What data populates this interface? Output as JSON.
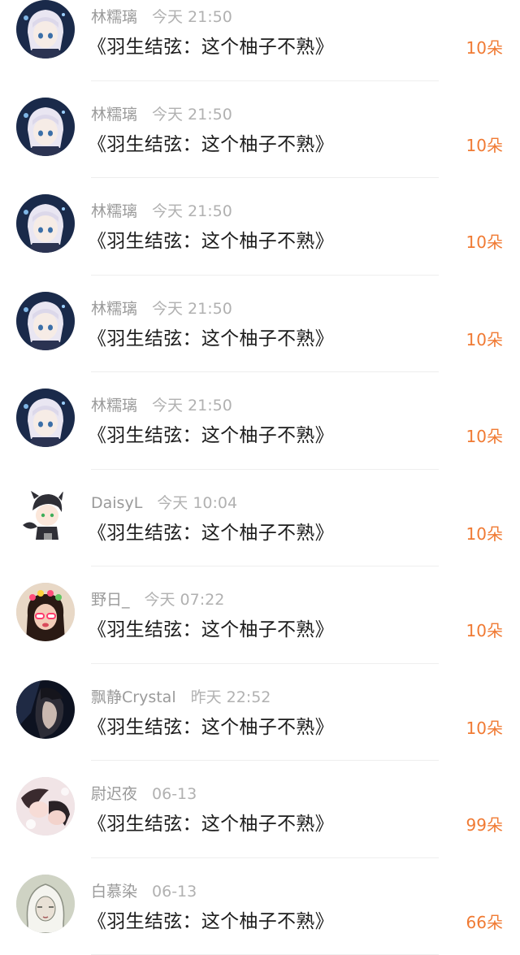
{
  "items": [
    {
      "user": "林糯璃",
      "time": "今天 21:50",
      "title": "《羽生结弦：这个柚子不熟》",
      "flowers": "10朵",
      "avatar": "anime-girl-avatar"
    },
    {
      "user": "林糯璃",
      "time": "今天 21:50",
      "title": "《羽生结弦：这个柚子不熟》",
      "flowers": "10朵",
      "avatar": "anime-girl-avatar"
    },
    {
      "user": "林糯璃",
      "time": "今天 21:50",
      "title": "《羽生结弦：这个柚子不熟》",
      "flowers": "10朵",
      "avatar": "anime-girl-avatar"
    },
    {
      "user": "林糯璃",
      "time": "今天 21:50",
      "title": "《羽生结弦：这个柚子不熟》",
      "flowers": "10朵",
      "avatar": "anime-girl-avatar"
    },
    {
      "user": "林糯璃",
      "time": "今天 21:50",
      "title": "《羽生结弦：这个柚子不熟》",
      "flowers": "10朵",
      "avatar": "anime-girl-avatar"
    },
    {
      "user": "DaisyL",
      "time": "今天 10:04",
      "title": "《羽生结弦：这个柚子不熟》",
      "flowers": "10朵",
      "avatar": "chibi-boy-cat-avatar"
    },
    {
      "user": "野日_",
      "time": "今天 07:22",
      "title": "《羽生结弦：这个柚子不熟》",
      "flowers": "10朵",
      "avatar": "girl-flower-crown-avatar"
    },
    {
      "user": "飘静Crystal",
      "time": "昨天 22:52",
      "title": "《羽生结弦：这个柚子不熟》",
      "flowers": "10朵",
      "avatar": "dark-portrait-avatar"
    },
    {
      "user": "尉迟夜",
      "time": "06-13",
      "title": "《羽生结弦：这个柚子不熟》",
      "flowers": "99朵",
      "avatar": "couple-illustration-avatar"
    },
    {
      "user": "白慕染",
      "time": "06-13",
      "title": "《羽生结弦：这个柚子不熟》",
      "flowers": "66朵",
      "avatar": "hooded-sketch-avatar"
    }
  ],
  "colors": {
    "accent": "#f07a33",
    "name": "#9a9a9a",
    "title": "#1d1d1d"
  }
}
